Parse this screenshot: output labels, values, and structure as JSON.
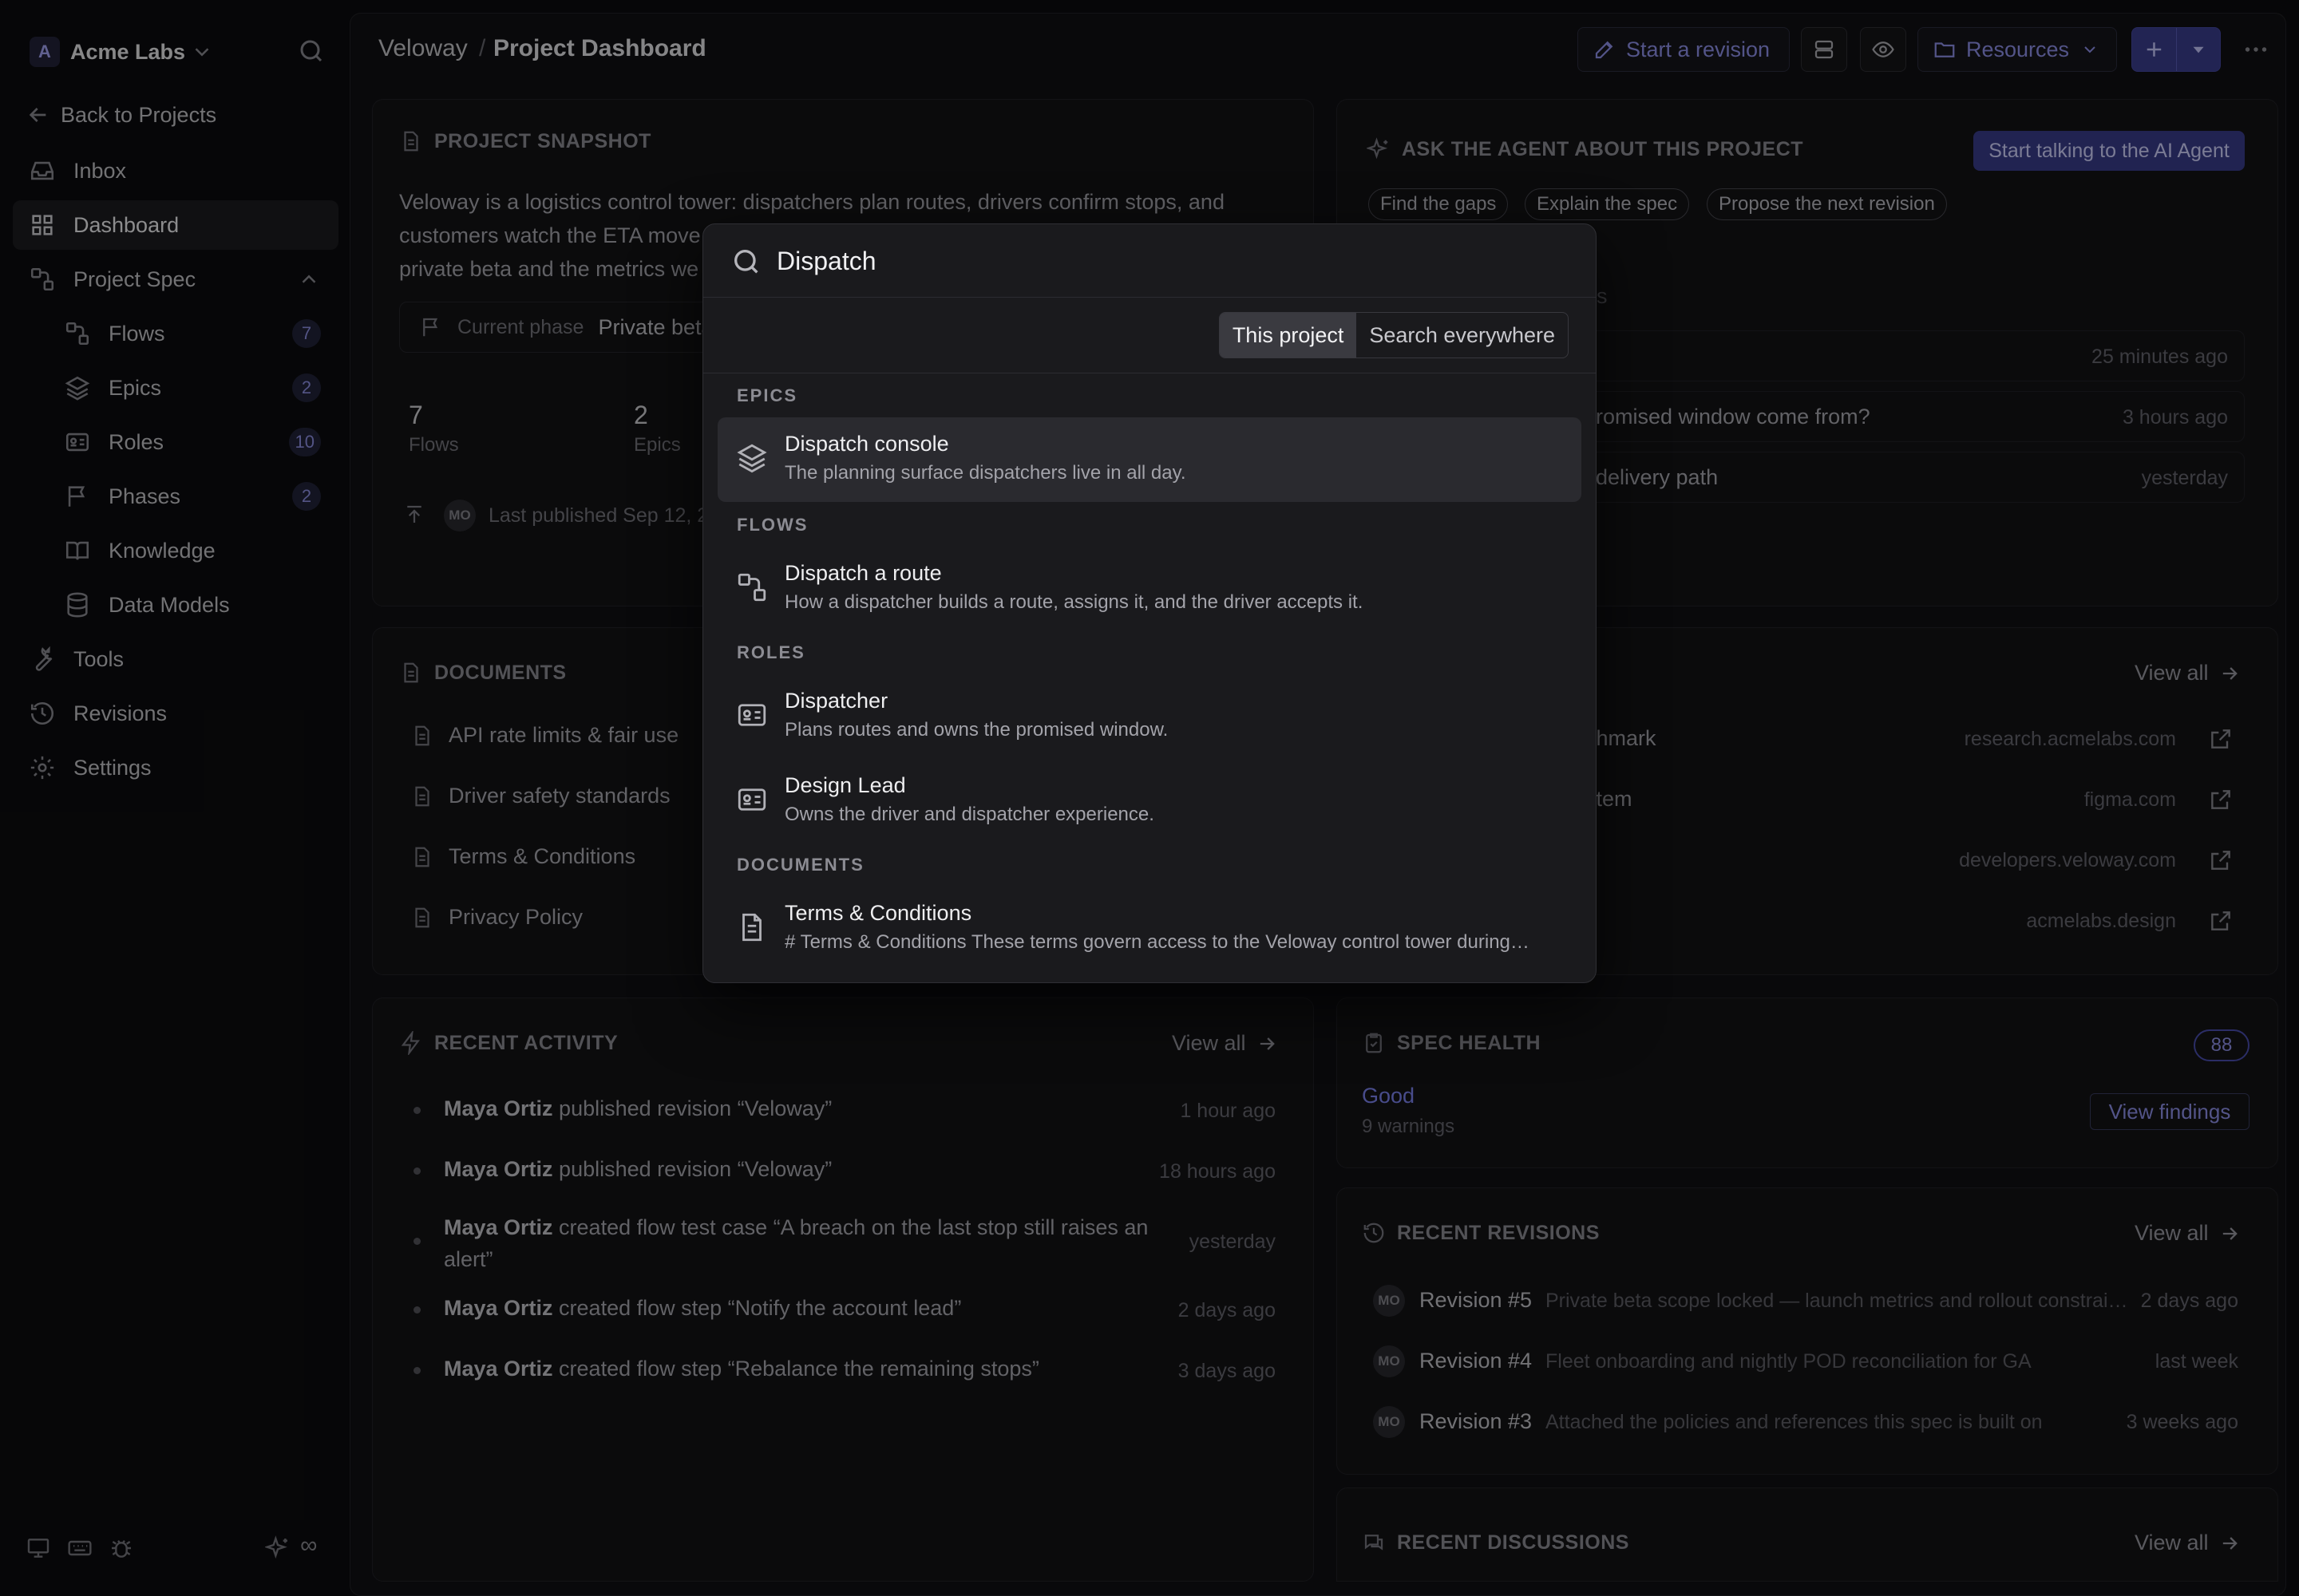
{
  "workspace": {
    "avatar": "A",
    "name": "Acme Labs"
  },
  "sidebar": {
    "back": "Back to Projects",
    "items": [
      {
        "label": "Inbox"
      },
      {
        "label": "Dashboard"
      },
      {
        "label": "Project Spec"
      },
      {
        "label": "Flows",
        "count": "7"
      },
      {
        "label": "Epics",
        "count": "2"
      },
      {
        "label": "Roles",
        "count": "10"
      },
      {
        "label": "Phases",
        "count": "2"
      },
      {
        "label": "Knowledge"
      },
      {
        "label": "Data Models"
      },
      {
        "label": "Tools"
      },
      {
        "label": "Revisions"
      },
      {
        "label": "Settings"
      }
    ],
    "footer_infinity": "∞"
  },
  "header": {
    "crumb_project": "Veloway",
    "crumb_sep": "/",
    "crumb_page": "Project Dashboard",
    "start_revision": "Start a revision",
    "resources": "Resources"
  },
  "snapshot": {
    "title": "PROJECT SNAPSHOT",
    "description_1": "Veloway is a logistics control tower: dispatchers plan routes, drivers confirm stops, and",
    "description_2": "customers watch the ETA move",
    "description_3": "private beta and the metrics we",
    "phase_label": "Current phase",
    "phase_value": "Private beta",
    "stat1_value": "7",
    "stat1_label": "Flows",
    "stat2_value": "2",
    "stat2_label": "Epics",
    "avatar": "MO",
    "published": "Last published Sep 12, 2"
  },
  "agent": {
    "title": "ASK THE AGENT ABOUT THIS PROJECT",
    "cta": "Start talking to the AI Agent",
    "chips": [
      "Find the gaps",
      "Explain the spec",
      "Propose the next revision"
    ],
    "heading_fragment": "s",
    "threads": [
      {
        "text": "",
        "time": "25 minutes ago"
      },
      {
        "text": "romised window come from?",
        "time": "3 hours ago"
      },
      {
        "text": "delivery path",
        "time": "yesterday"
      }
    ]
  },
  "documents": {
    "title": "DOCUMENTS",
    "items": [
      "API rate limits & fair use",
      "Driver safety standards",
      "Terms & Conditions",
      "Privacy Policy"
    ]
  },
  "references": {
    "view_all": "View all",
    "items": [
      {
        "text": "chmark",
        "domain": "research.acmelabs.com"
      },
      {
        "text": "stem",
        "domain": "figma.com"
      },
      {
        "text": "",
        "domain": "developers.veloway.com"
      },
      {
        "text": "",
        "domain": "acmelabs.design"
      }
    ]
  },
  "activity": {
    "title": "RECENT ACTIVITY",
    "view_all": "View all",
    "items": [
      {
        "who": "Maya Ortiz",
        "what": " published revision “Veloway”",
        "what2": "",
        "time": "1 hour ago"
      },
      {
        "who": "Maya Ortiz",
        "what": " published revision “Veloway”",
        "what2": "",
        "time": "18 hours ago"
      },
      {
        "who": "Maya Ortiz",
        "what": " created flow test case “A breach on the last stop still raises an",
        "what2": "alert”",
        "time": "yesterday"
      },
      {
        "who": "Maya Ortiz",
        "what": " created flow step “Notify the account lead”",
        "what2": "",
        "time": "2 days ago"
      },
      {
        "who": "Maya Ortiz",
        "what": " created flow step “Rebalance the remaining stops”",
        "what2": "",
        "time": "3 days ago"
      }
    ]
  },
  "health": {
    "title": "SPEC HEALTH",
    "score": "88",
    "status": "Good",
    "warnings": "9 warnings",
    "findings": "View findings",
    "status_color": "#7d84f0"
  },
  "revisions": {
    "title": "RECENT REVISIONS",
    "view_all": "View all",
    "items": [
      {
        "avatar": "MO",
        "name": "Revision #5",
        "desc": "Private beta scope locked — launch metrics and rollout constrai…",
        "time": "2 days ago"
      },
      {
        "avatar": "MO",
        "name": "Revision #4",
        "desc": "Fleet onboarding and nightly POD reconciliation for GA",
        "time": "last week"
      },
      {
        "avatar": "MO",
        "name": "Revision #3",
        "desc": "Attached the policies and references this spec is built on",
        "time": "3 weeks ago"
      }
    ]
  },
  "discussions": {
    "title": "RECENT DISCUSSIONS",
    "view_all": "View all"
  },
  "palette": {
    "query": "Dispatch",
    "scope_this": "This project",
    "scope_all": "Search everywhere",
    "sections": {
      "epics": "EPICS",
      "flows": "FLOWS",
      "roles": "ROLES",
      "documents": "DOCUMENTS"
    },
    "results": [
      {
        "icon": "layers-icon",
        "title": "Dispatch console",
        "desc": "The planning surface dispatchers live in all day."
      },
      {
        "icon": "flow-icon",
        "title": "Dispatch a route",
        "desc": "How a dispatcher builds a route, assigns it, and the driver accepts it."
      },
      {
        "icon": "id-card-icon",
        "title": "Dispatcher",
        "desc": "Plans routes and owns the promised window."
      },
      {
        "icon": "id-card-icon",
        "title": "Design Lead",
        "desc": "Owns the driver and dispatcher experience."
      },
      {
        "icon": "document-icon",
        "title": "Terms & Conditions",
        "desc": "# Terms & Conditions These terms govern access to the Veloway control tower during…"
      }
    ]
  },
  "colors": {
    "accent": "#8f92ea",
    "background": "#0c0c0e"
  }
}
